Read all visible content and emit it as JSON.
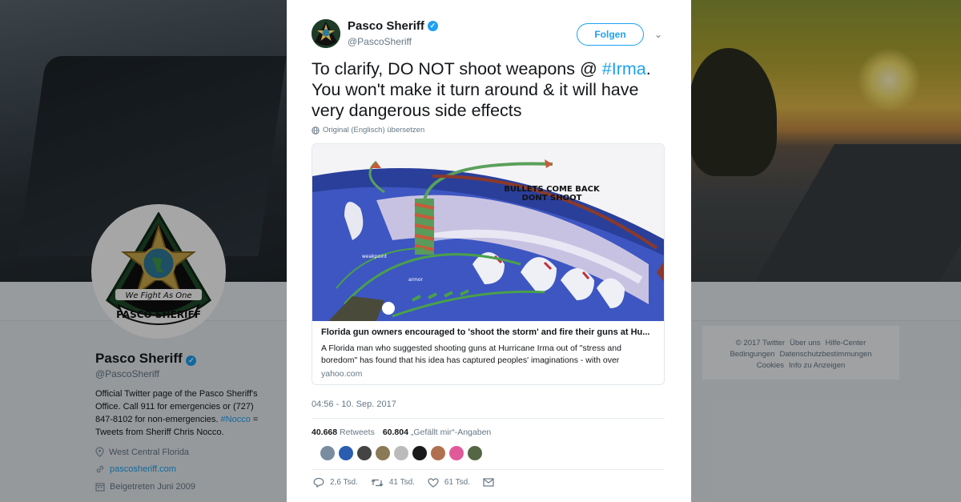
{
  "profile": {
    "name": "Pasco Sheriff",
    "handle": "@PascoSheriff",
    "badge_motto": "We Fight As One",
    "badge_name": "PASCO SHERIFF",
    "bio_part1": "Official Twitter page of the Pasco Sheriff's Office. Call 911 for emergencies or (727) 847-8102 for non-emergencies.",
    "bio_tag": "#Nocco",
    "bio_part2": "= Tweets from Sheriff Chris Nocco.",
    "location": "West Central Florida",
    "website": "pascosheriff.com",
    "joined": "Beigetreten Juni 2009"
  },
  "footer": {
    "line1": [
      "© 2017 Twitter",
      "Über uns",
      "Hilfe-Center"
    ],
    "line2": [
      "Bedingungen",
      "Datenschutzbestimmungen"
    ],
    "line3": [
      "Cookies",
      "Info zu Anzeigen"
    ]
  },
  "tweet": {
    "author_name": "Pasco Sheriff",
    "author_handle": "@PascoSheriff",
    "follow_label": "Folgen",
    "text_before": "To clarify, DO NOT shoot weapons @",
    "hashtag": "#Irma",
    "text_after": ". You won't make it turn around & it will have very dangerous side effects",
    "translate_label": "Original (Englisch) übersetzen",
    "timestamp": "04:56 - 10. Sep. 2017",
    "retweets_count": "40.668",
    "retweets_label": "Retweets",
    "likes_count": "60.804",
    "likes_label": "„Gefällt mir“-Angaben",
    "reply_count": "2,6 Tsd.",
    "retweet_action_count": "41 Tsd.",
    "like_action_count": "61 Tsd."
  },
  "card": {
    "image_text_1": "BULLETS COME BACK",
    "image_text_2": "DONT SHOOT",
    "image_label_weakpoint": "weakpoint",
    "image_label_armor": "armor",
    "title": "Florida gun owners encouraged to 'shoot the storm' and fire their guns at Hu...",
    "description": "A Florida man who suggested shooting guns at Hurricane Irma out of \"stress and boredom\" has found that his idea has captured peoples' imaginations - with over",
    "domain": "yahoo.com"
  },
  "colors": {
    "accent": "#1da1f2",
    "text": "#14171a",
    "muted": "#657786"
  },
  "liker_colors": [
    "#7a8da0",
    "#2a5db0",
    "#444444",
    "#8a7a55",
    "#bbbbbb",
    "#1a1a1a",
    "#b07050",
    "#e05a9a",
    "#556644"
  ]
}
